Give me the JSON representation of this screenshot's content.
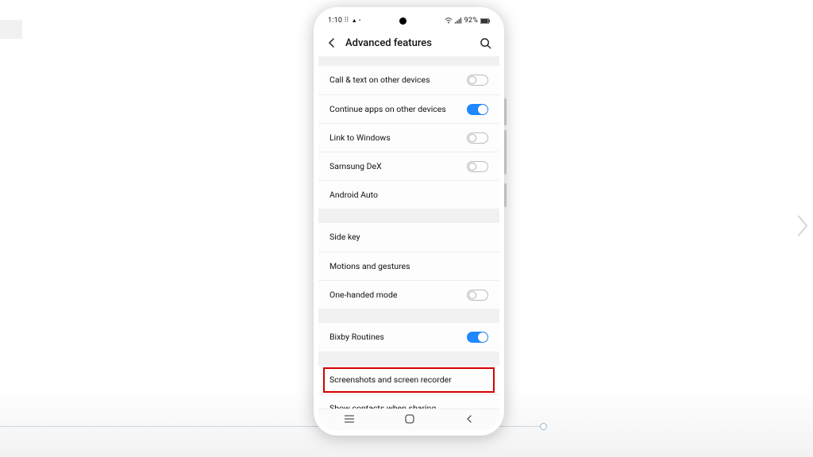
{
  "statusbar": {
    "time": "1:10",
    "battery": "92%"
  },
  "header": {
    "title": "Advanced features"
  },
  "rows": [
    {
      "label": "Call & text on other devices"
    },
    {
      "label": "Continue apps on other devices"
    },
    {
      "label": "Link to Windows"
    },
    {
      "label": "Samsung DeX"
    },
    {
      "label": "Android Auto"
    },
    {
      "label": "Side key"
    },
    {
      "label": "Motions and gestures"
    },
    {
      "label": "One-handed mode"
    },
    {
      "label": "Bixby Routines"
    },
    {
      "label": "Screenshots and screen recorder"
    },
    {
      "label": "Show contacts when sharing content"
    }
  ],
  "toggles": {
    "call_text": false,
    "continue_apps": true,
    "link_windows": false,
    "samsung_dex": false,
    "one_handed": false,
    "bixby": true,
    "show_contacts": true
  }
}
